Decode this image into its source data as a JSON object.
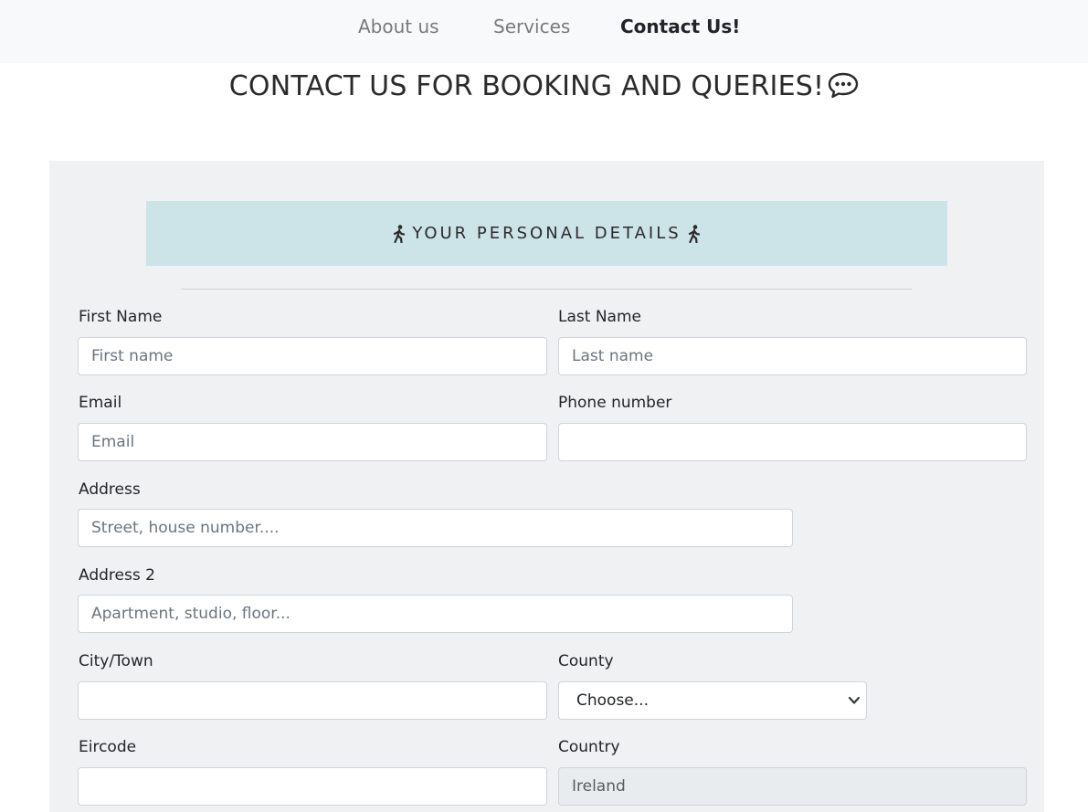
{
  "nav": {
    "items": [
      {
        "label": "About us"
      },
      {
        "label": "Services"
      },
      {
        "label": "Contact Us!"
      }
    ]
  },
  "page": {
    "title": "CONTACT US FOR BOOKING AND QUERIES!",
    "title_icon": "speech-bubble-icon"
  },
  "section": {
    "title": "YOUR PERSONAL DETAILS",
    "icon": "walking-person-icon"
  },
  "form": {
    "first_name": {
      "label": "First Name",
      "placeholder": "First name",
      "value": ""
    },
    "last_name": {
      "label": "Last Name",
      "placeholder": "Last name",
      "value": ""
    },
    "email": {
      "label": "Email",
      "placeholder": "Email",
      "value": ""
    },
    "phone": {
      "label": "Phone number",
      "placeholder": "",
      "value": ""
    },
    "address": {
      "label": "Address",
      "placeholder": "Street, house number....",
      "value": ""
    },
    "address2": {
      "label": "Address 2",
      "placeholder": "Apartment, studio, floor...",
      "value": ""
    },
    "city": {
      "label": "City/Town",
      "placeholder": "",
      "value": ""
    },
    "county": {
      "label": "County",
      "selected": "Choose..."
    },
    "eircode": {
      "label": "Eircode",
      "placeholder": "",
      "value": ""
    },
    "country": {
      "label": "Country",
      "value": "Ireland"
    }
  },
  "colors": {
    "nav_bg": "#f8f9fa",
    "panel_bg": "#f0f1f3",
    "banner_bg": "#cce3e8",
    "readonly_bg": "#e9ecef"
  }
}
